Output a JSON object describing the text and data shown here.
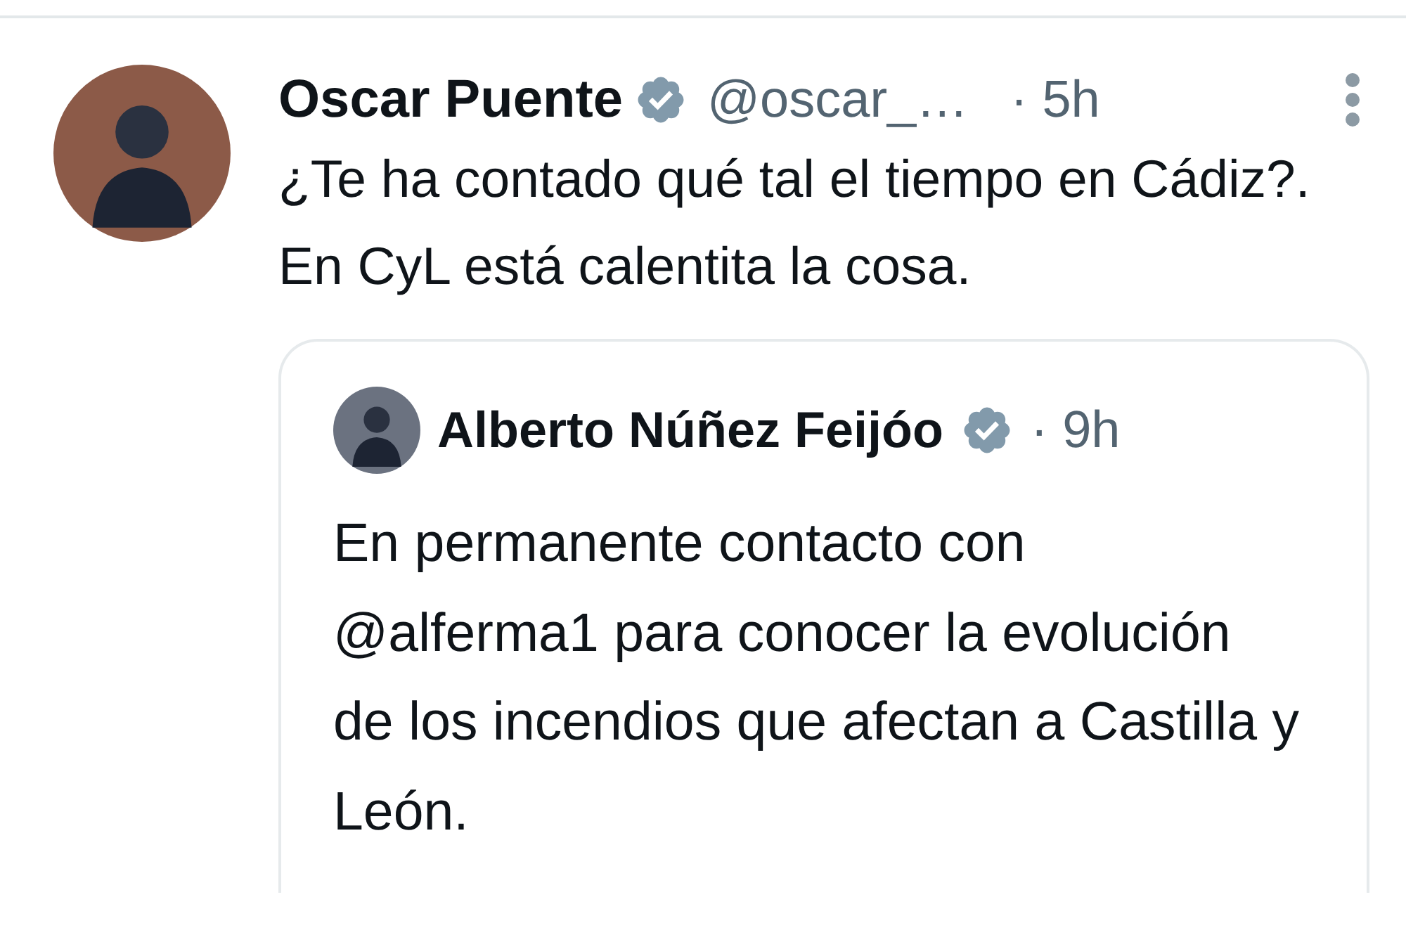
{
  "tweet": {
    "author": "Oscar Puente",
    "verified": true,
    "handle": "@oscar_…",
    "time": "· 5h",
    "text": "¿Te ha contado qué tal el tiempo en Cádiz?. En CyL está calentita la cosa.",
    "quote": {
      "author": "Alberto Núñez Feijóo",
      "verified": true,
      "time": "· 9h",
      "text": "En permanente contacto con @alferma1 para conocer la evolución de los incendios que afectan a Castilla y León."
    }
  }
}
